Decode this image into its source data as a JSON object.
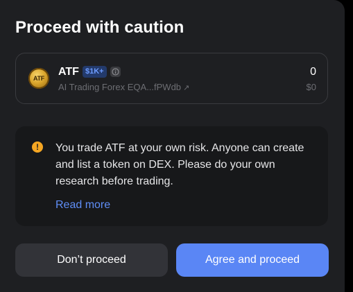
{
  "dialog": {
    "title": "Proceed with caution"
  },
  "token": {
    "logo_text": "ATF",
    "symbol": "ATF",
    "mcap_badge": "$1K+",
    "name": "AI Trading Forex",
    "address": "EQA...fPWdb",
    "address_arrow": "↗",
    "amount": "0",
    "value": "$0"
  },
  "warning": {
    "icon": "!",
    "text": "You trade ATF at your own risk. Anyone can create and list a token on DEX. Please do your own research before trading.",
    "read_more": "Read more"
  },
  "buttons": {
    "cancel_label": "Don’t proceed",
    "agree_label": "Agree and proceed"
  },
  "colors": {
    "background": "#1e1f22",
    "accent": "#5a86f5",
    "warning": "#f5a623",
    "link": "#5f8ef7"
  }
}
